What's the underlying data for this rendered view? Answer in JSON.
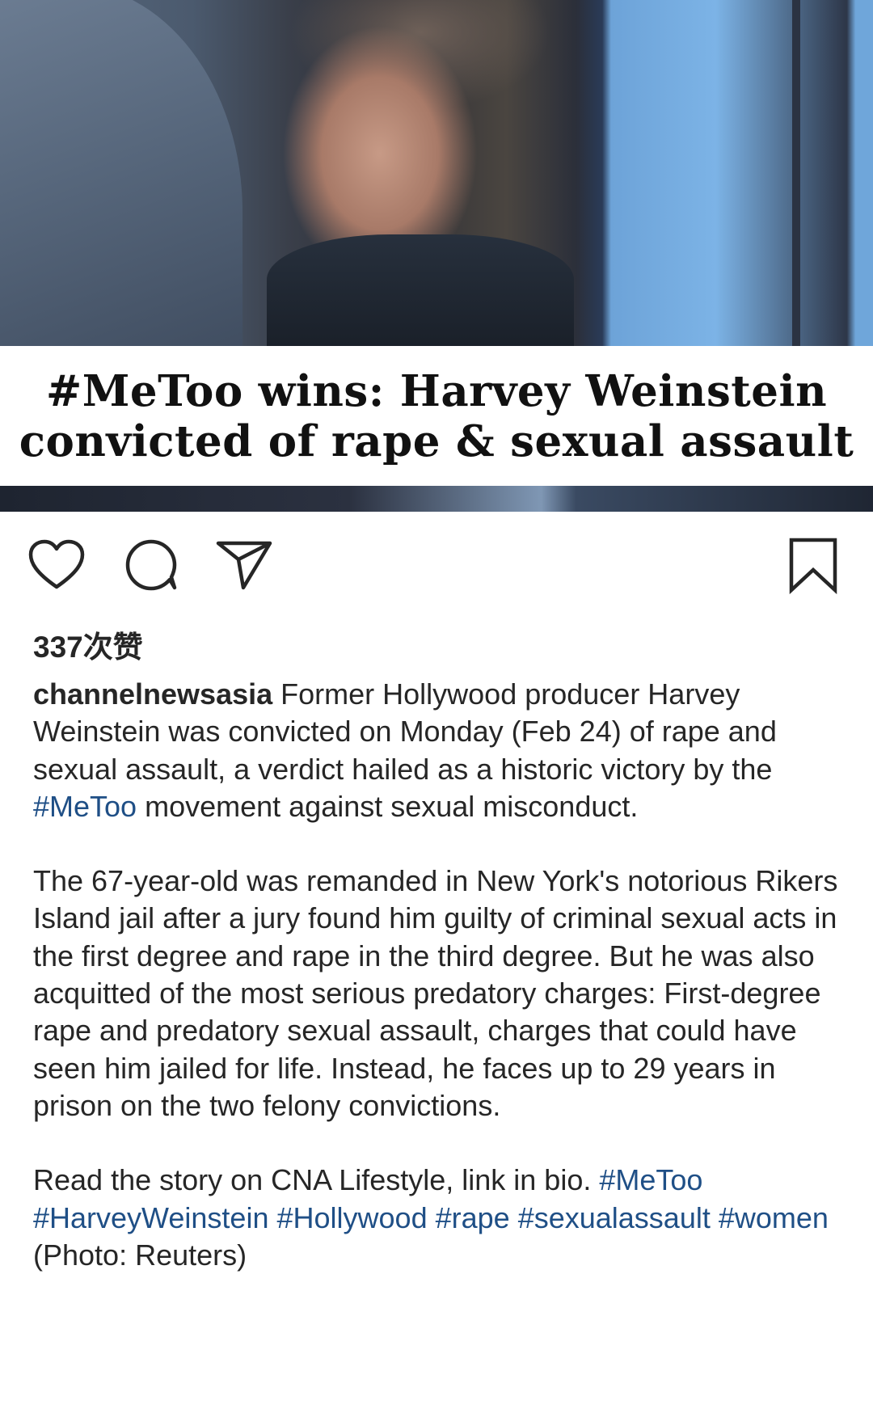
{
  "post": {
    "image": {
      "headline_line1": "#MeToo wins: Harvey Weinstein",
      "headline_line2": "convicted of rape & sexual assault"
    },
    "actions": {
      "like_icon": "heart-icon",
      "comment_icon": "comment-icon",
      "share_icon": "share-icon",
      "save_icon": "bookmark-icon"
    },
    "likes_text": "337次赞",
    "caption": {
      "username": "channelnewsasia",
      "p1_a": " Former Hollywood producer Harvey Weinstein was convicted on Monday (Feb 24) of rape and sexual assault, a verdict hailed as a historic victory by the ",
      "p1_tag": "#MeToo",
      "p1_b": " movement against sexual misconduct.",
      "p2": "The 67-year-old was remanded in New York's notorious Rikers Island jail after a jury found him guilty of criminal sexual acts in the first degree and rape in the third degree. But he was also acquitted of the most serious predatory charges: First-degree rape and predatory sexual assault, charges that could have seen him jailed for life. Instead, he faces up to 29 years in prison on the two felony convictions.",
      "p3_a": "Read the story on CNA Lifestyle, link in bio. ",
      "tags": [
        "#MeToo",
        "#HarveyWeinstein",
        "#Hollywood",
        "#rape",
        "#sexualassault",
        "#women"
      ],
      "p3_b": " (Photo: Reuters)"
    },
    "colors": {
      "text": "#262626",
      "hashtag": "#1f4f86",
      "background": "#ffffff"
    }
  }
}
